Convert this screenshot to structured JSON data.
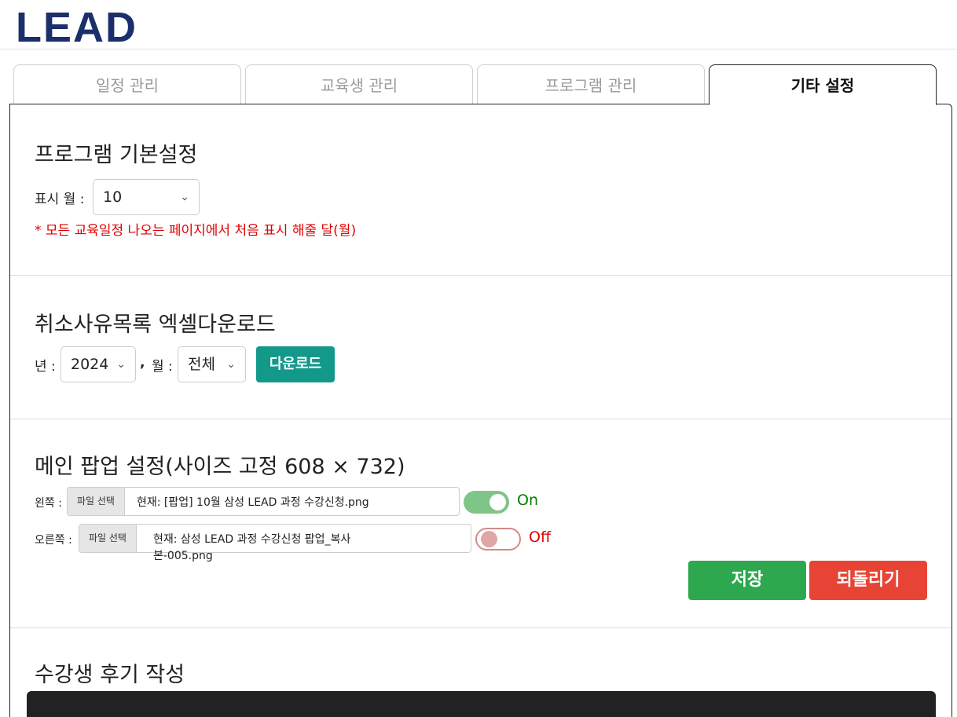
{
  "header": {
    "logo": "LEAD"
  },
  "tabs": [
    {
      "label": "일정 관리",
      "active": false
    },
    {
      "label": "교육생 관리",
      "active": false
    },
    {
      "label": "프로그램 관리",
      "active": false
    },
    {
      "label": "기타 설정",
      "active": true
    }
  ],
  "program_settings": {
    "title": "프로그램 기본설정",
    "month_label": "표시 월 :",
    "month_value": "10",
    "note": "* 모든 교육일정 나오는 페이지에서 처음 표시 해줄 달(월)"
  },
  "cancel_download": {
    "title": "취소사유목록 엑셀다운로드",
    "year_label": "년 :",
    "year_value": "2024",
    "comma": ",",
    "month_label": "월 :",
    "month_value": "전체",
    "download_label": "다운로드"
  },
  "popup_settings": {
    "title": "메인 팝업 설정(사이즈 고정 608 × 732)",
    "left_label": "왼쪽 :",
    "left_file_button": "파일 선택",
    "left_file_name": "현재: [팝업] 10월 삼성 LEAD 과정 수강신청.png",
    "left_toggle_state": "On",
    "right_label": "오른쪽 :",
    "right_file_button": "파일 선택",
    "right_file_name_line1": "현재: 삼성 LEAD 과정 수강신청 팝업_복사",
    "right_file_name_line2": "본-005.png",
    "right_toggle_state": "Off",
    "save_label": "저장",
    "revert_label": "되돌리기",
    "colors": {
      "on": "#008000",
      "off": "#e00000",
      "save": "#2ea84f",
      "revert": "#e74436"
    }
  },
  "review": {
    "title": "수강생 후기 작성"
  }
}
